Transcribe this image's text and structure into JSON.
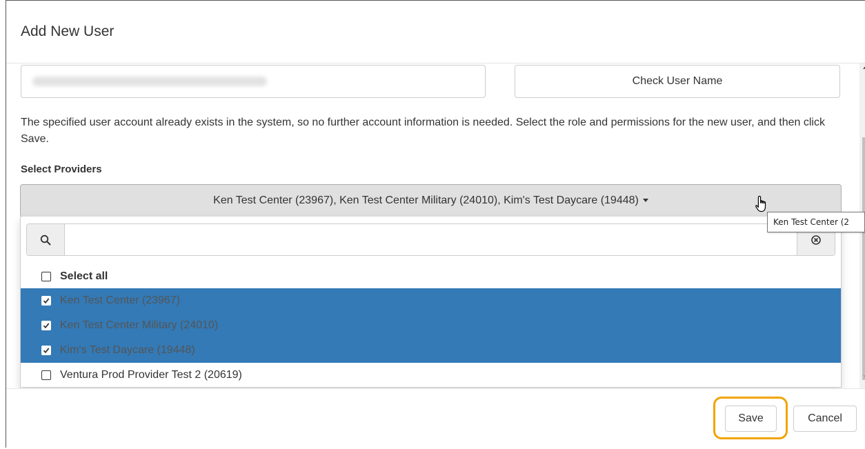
{
  "modal": {
    "title": "Add New User"
  },
  "user_lookup": {
    "email_value": "",
    "check_button_label": "Check User Name"
  },
  "info_text": "The specified user account already exists in the system, so no further account information is needed. Select the role and permissions for the new user, and then click Save.",
  "providers": {
    "label": "Select Providers",
    "button_text": "Ken Test Center (23967), Ken Test Center Military (24010), Kim's Test Daycare (19448)",
    "search_placeholder": "",
    "select_all_label": "Select all",
    "options": [
      {
        "label": "Ken Test Center (23967)",
        "checked": true
      },
      {
        "label": "Ken Test Center Military (24010)",
        "checked": true
      },
      {
        "label": "Kim's Test Daycare (19448)",
        "checked": true
      },
      {
        "label": "Ventura Prod Provider Test 2 (20619)",
        "checked": false
      }
    ]
  },
  "tooltip_text": "Ken Test Center (2",
  "footer": {
    "save_label": "Save",
    "cancel_label": "Cancel"
  },
  "colors": {
    "selected_bg": "#337ab7",
    "highlight_ring": "#f0a500",
    "dropdown_button_bg": "#e0e0e0"
  },
  "icons": [
    "search-icon",
    "clear-icon",
    "caret-down-icon",
    "hand-cursor-icon",
    "checkmark-icon"
  ]
}
